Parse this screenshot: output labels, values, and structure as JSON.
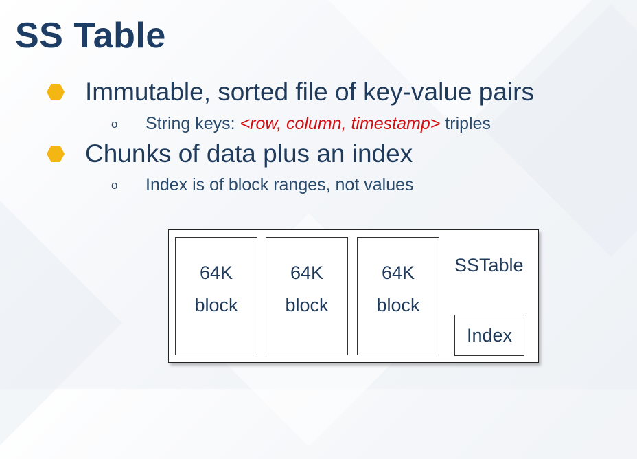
{
  "slide": {
    "title": "SS Table",
    "bullets": [
      {
        "text": "Immutable, sorted file of key-value pairs",
        "sub": {
          "marker": "o",
          "prefix": "String keys: ",
          "highlight": "<row, column, timestamp>",
          "suffix": " triples"
        }
      },
      {
        "text": "Chunks of data plus an index",
        "sub": {
          "marker": "o",
          "text": "Index is of block ranges, not values"
        }
      }
    ],
    "bullet_color": "#f3b612",
    "highlight_color": "#d10e10"
  },
  "diagram": {
    "blocks": [
      {
        "line1": "64K",
        "line2": "block"
      },
      {
        "line1": "64K",
        "line2": "block"
      },
      {
        "line1": "64K",
        "line2": "block"
      }
    ],
    "sstable_label": "SSTable",
    "index_label": "Index"
  }
}
